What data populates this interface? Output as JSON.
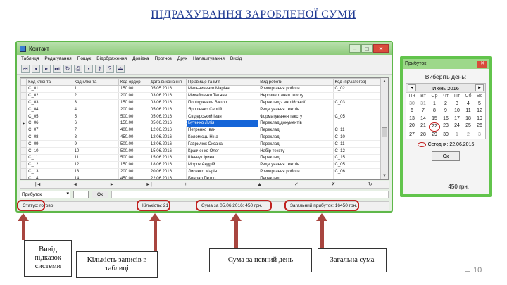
{
  "slide_title": "ПІДРАХУВАННЯ ЗАРОБЛЕНОЇ СУМИ",
  "main_window": {
    "title": "Контакт",
    "menu": [
      "Таблиця",
      "Редагування",
      "Пошук",
      "Відображення",
      "Довідка",
      "Прогнoз",
      "Друк",
      "Налаштування",
      "Вихід"
    ],
    "columns": [
      "Код клієнта",
      "Код клієнта",
      "Код ордер",
      "Дата виконання",
      "Прізвище та ім'я",
      "Вид роботи",
      "Код (пр\\категор)"
    ],
    "rows": [
      [
        "С_01",
        "1",
        "150.00",
        "05.05.2016",
        "Мельниченко Маріна",
        "Розвертання роботи",
        "С_02"
      ],
      [
        "С_02",
        "2",
        "200.00",
        "03.06.2016",
        "Михайленко Тетяна",
        "Нерозвертання тексту",
        ""
      ],
      [
        "С_03",
        "3",
        "150.00",
        "03.06.2016",
        "Поліщукевич Віктор",
        "Переклад з англійської",
        "С_03"
      ],
      [
        "С_04",
        "4",
        "200.00",
        "05.06.2016",
        "Ярошенко Сергій",
        "Редагування текстів",
        ""
      ],
      [
        "С_05",
        "5",
        "500.00",
        "05.06.2016",
        "Свідерський Іван",
        "Форматування тексту",
        "С_05"
      ],
      [
        "С_06",
        "6",
        "150.00",
        "05.06.2016",
        "Бутенко Лілія",
        "Переклад документів",
        ""
      ],
      [
        "С_07",
        "7",
        "400.00",
        "12.06.2016",
        "Петренко Іван",
        "Переклад",
        "С_11"
      ],
      [
        "С_08",
        "8",
        "450.00",
        "12.06.2016",
        "Коломієць Ніна",
        "Переклад",
        "С_10"
      ],
      [
        "С_09",
        "9",
        "500.00",
        "12.06.2016",
        "Гаврилюк Оксана",
        "Переклад",
        "С_11"
      ],
      [
        "С_10",
        "10",
        "500.00",
        "15.06.2016",
        "Кравченко Олег",
        "Набір тексту",
        "С_12"
      ],
      [
        "С_11",
        "11",
        "500.00",
        "15.06.2016",
        "Шевчук Ірина",
        "Переклад",
        "С_15"
      ],
      [
        "С_12",
        "12",
        "150.00",
        "18.06.2016",
        "Мороз Андрій",
        "Редагування текстів",
        "С_05"
      ],
      [
        "С_13",
        "13",
        "200.00",
        "20.06.2016",
        "Лисенко Марія",
        "Розвертання роботи",
        "С_06"
      ],
      [
        "С_14",
        "14",
        "450.00",
        "22.06.2016",
        "Бондар Петро",
        "Переклад",
        ""
      ]
    ],
    "navigator": [
      "|◄",
      "◄",
      "►",
      "►|",
      "+",
      "−",
      "▲",
      "✓",
      "✗",
      "↻"
    ],
    "filter_value": "Прибуток",
    "ok_label": "Ок",
    "status": {
      "hints": "Статус: готово",
      "records": "Кількість: 21",
      "sum_day": "Сума за 05.06.2016: 450 грн.",
      "sum_total": "Загальний прибуток: 16450 грн."
    }
  },
  "calendar_window": {
    "title": "Прибуток",
    "prompt": "Виберіть день:",
    "month": "Июнь 2016",
    "weekdays": [
      "Пн",
      "Вт",
      "Ср",
      "Чт",
      "Пт",
      "Сб",
      "Вс"
    ],
    "days": [
      "30",
      "31",
      "1",
      "2",
      "3",
      "4",
      "5",
      "6",
      "7",
      "8",
      "9",
      "10",
      "11",
      "12",
      "13",
      "14",
      "15",
      "16",
      "17",
      "18",
      "19",
      "20",
      "21",
      "22",
      "23",
      "24",
      "25",
      "26",
      "27",
      "28",
      "29",
      "30",
      "1",
      "2",
      "3"
    ],
    "today_label": "Сегодня: 22.06.2016",
    "ok_label": "Ок",
    "sum": "450 грн."
  },
  "captions": {
    "hints": "Вивід підказок системи",
    "records": "Кількість записів в таблиці",
    "sum_day": "Сума за певний день",
    "sum_total": "Загальна сума"
  },
  "page_number": "10",
  "colors": {
    "window_border": "#5fb84a",
    "highlight": "#c0211f",
    "arrow": "#a8453f",
    "title": "#1f3a93"
  }
}
